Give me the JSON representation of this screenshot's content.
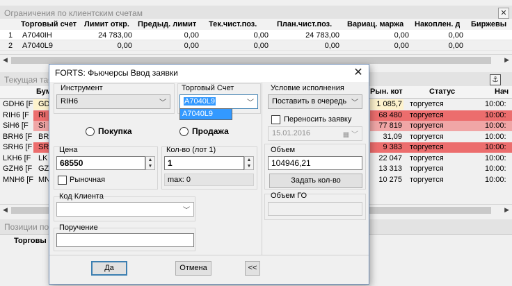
{
  "accounts_panel": {
    "title": "Ограничения по клиентским счетам",
    "close_glyph": "✕",
    "columns": [
      "Торговый счет",
      "Лимит откр.",
      "Предыд. лимит",
      "Тек.чист.поз.",
      "План.чист.поз.",
      "Вариац. маржа",
      "Накоплен. д",
      "Биржевы"
    ],
    "rows": [
      {
        "num": "1",
        "account": "A7040IH",
        "limit": "24 783,00",
        "prev_limit": "0,00",
        "cur_net": "0,00",
        "plan_net": "24 783,00",
        "var_margin": "0,00",
        "accum": "0,00"
      },
      {
        "num": "2",
        "account": "A7040L9",
        "limit": "0,00",
        "prev_limit": "0,00",
        "cur_net": "0,00",
        "plan_net": "0,00",
        "var_margin": "0,00",
        "accum": "0,00"
      }
    ]
  },
  "current_table": {
    "title": "Текущая табл",
    "anchor_glyph": "⚓",
    "col_code_partial": "Бум",
    "col_market_price": "Рын. кот",
    "col_status": "Статус",
    "col_start_partial": "Нач",
    "rows": [
      {
        "code": "GDH6 [F",
        "mid": "GD",
        "price": "1 085,7",
        "status": "торгуется",
        "time": "10:00:",
        "color": "#fdf2cc"
      },
      {
        "code": "RIH6 [F",
        "mid": "RI",
        "price": "68 480",
        "status": "торгуется",
        "time": "10:00:",
        "color": "#ec6d6d"
      },
      {
        "code": "SiH6 [F",
        "mid": "Si",
        "price": "77 819",
        "status": "торгуется",
        "time": "10:00:",
        "color": "#f0a6a6"
      },
      {
        "code": "BRH6 [F",
        "mid": "BR",
        "price": "31,09",
        "status": "торгуется",
        "time": "10:00:",
        "color": ""
      },
      {
        "code": "SRH6 [F",
        "mid": "SR",
        "price": "9 383",
        "status": "торгуется",
        "time": "10:00:",
        "color": "#ec6d6d"
      },
      {
        "code": "LKH6 [F",
        "mid": "LK",
        "price": "22 047",
        "status": "торгуется",
        "time": "10:00:",
        "color": ""
      },
      {
        "code": "GZH6 [F",
        "mid": "GZ",
        "price": "13 313",
        "status": "торгуется",
        "time": "10:00:",
        "color": ""
      },
      {
        "code": "MNH6 [F",
        "mid": "MN",
        "price": "10 275",
        "status": "торгуется",
        "time": "10:00:",
        "color": ""
      }
    ]
  },
  "positions_panel": {
    "title": "Позиции по",
    "col_partial": "Торговы"
  },
  "dialog": {
    "title": "FORTS: Фьючерсы Ввод заявки",
    "close_glyph": "✕",
    "instrument_label": "Инструмент",
    "instrument_value": "RIH6",
    "account_label": "Торговый Счет",
    "account_value": "A7040L9",
    "account_dropdown_item": "A7040L9",
    "condition_label": "Условие исполнения",
    "condition_value": "Поставить в очередь",
    "buy_label": "Покупка",
    "sell_label": "Продажа",
    "transfer_label": "Переносить заявку",
    "transfer_date": "15.01.2016",
    "price_label": "Цена",
    "price_value": "68550",
    "qty_label": "Кол-во (лот 1)",
    "qty_value": "1",
    "market_label": "Рыночная",
    "max_text": "max: 0",
    "volume_label": "Объем",
    "volume_value": "104946,21",
    "set_qty_button": "Задать кол-во",
    "client_code_label": "Код Клиента",
    "client_code_value": "",
    "assignment_label": "Поручение",
    "assignment_value": "",
    "go_volume_label": "Объем ГО",
    "go_volume_value": "",
    "ok_button": "Да",
    "cancel_button": "Отмена",
    "collapse_button": "<<"
  }
}
